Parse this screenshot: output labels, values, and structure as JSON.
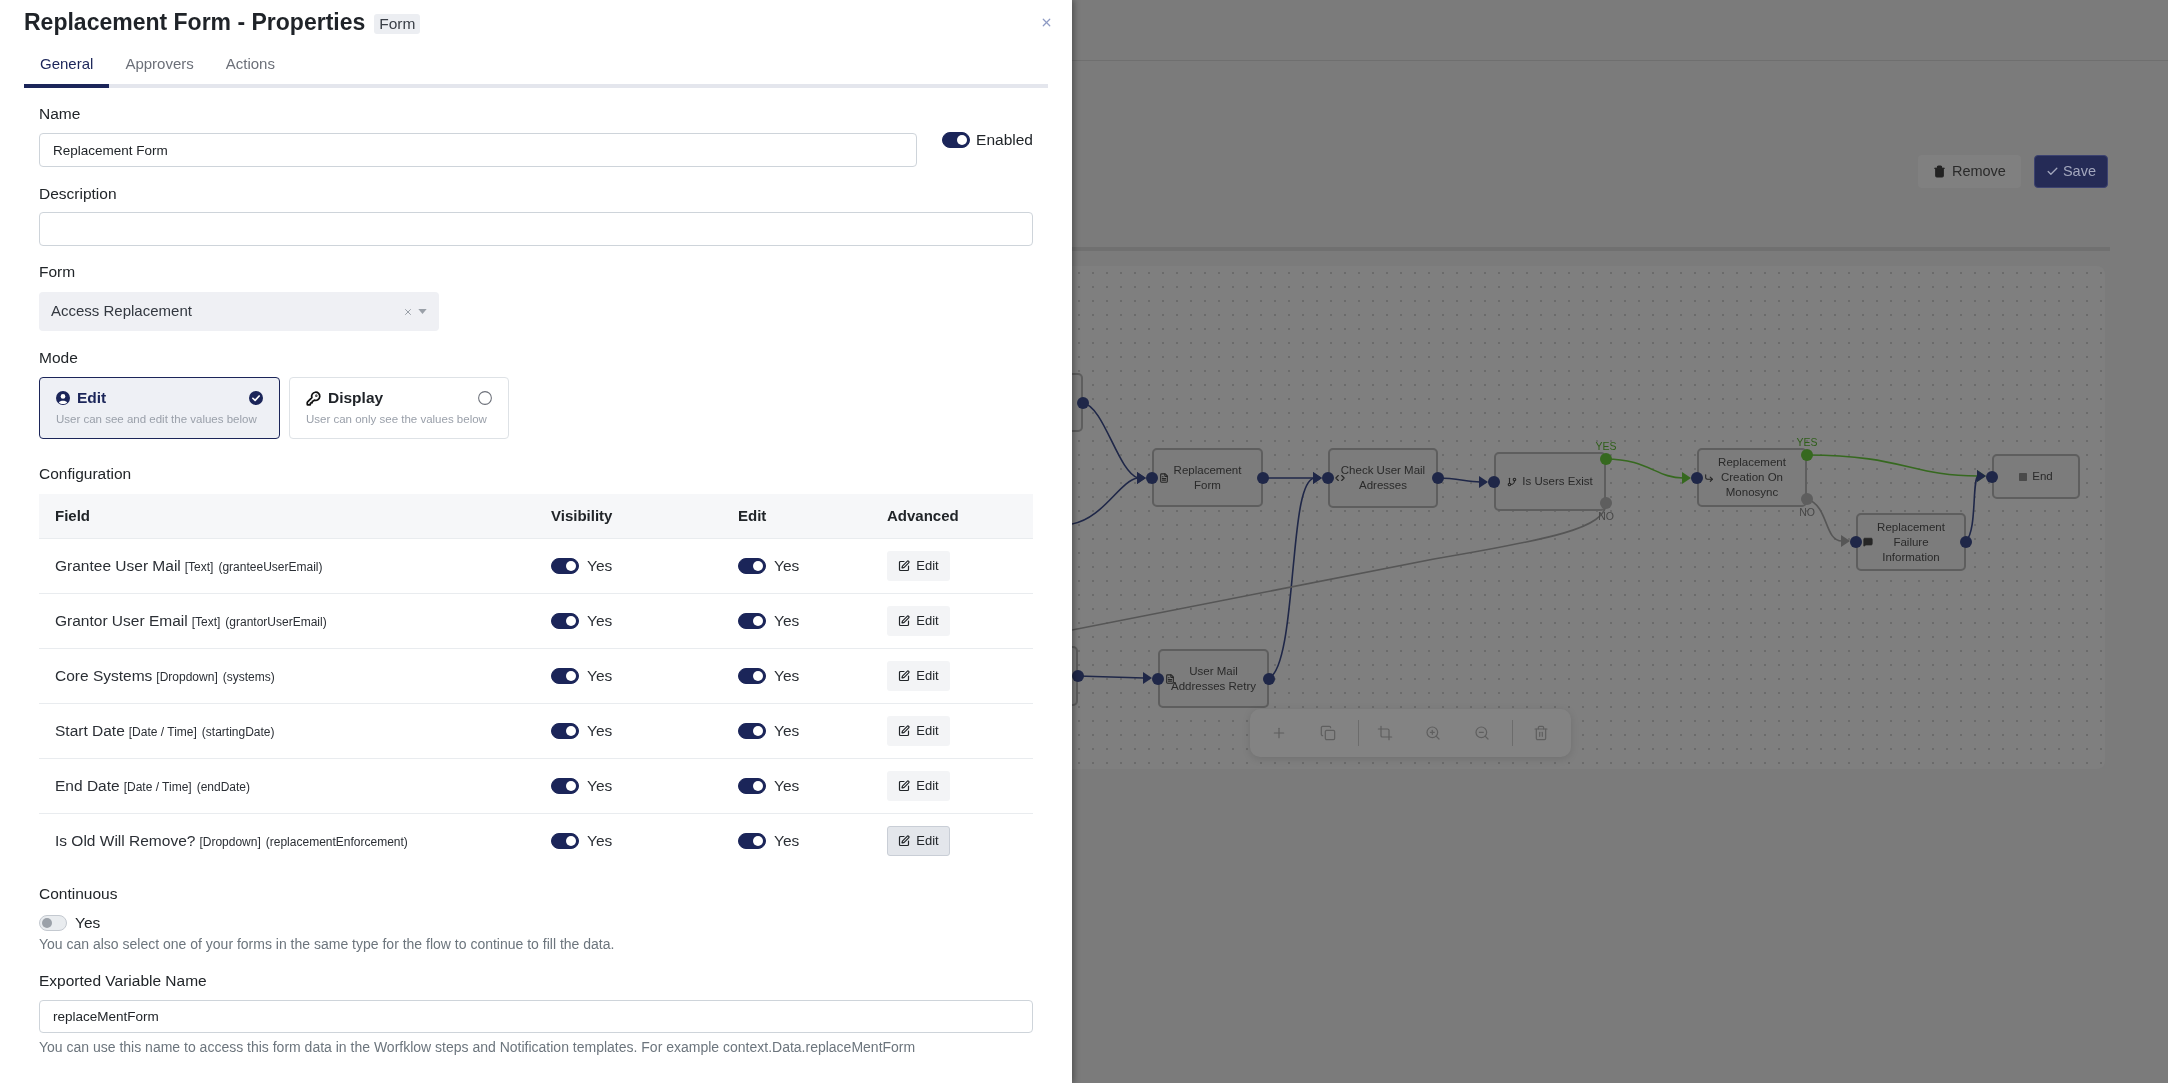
{
  "drawer": {
    "title": "Replacement Form - Properties",
    "badge": "Form",
    "tabs": [
      {
        "label": "General",
        "selected": true
      },
      {
        "label": "Approvers",
        "selected": false
      },
      {
        "label": "Actions",
        "selected": false
      }
    ]
  },
  "name": {
    "label": "Name",
    "value": "Replacement Form"
  },
  "enabled": {
    "label": "Enabled",
    "on": true
  },
  "description": {
    "label": "Description"
  },
  "form": {
    "label": "Form",
    "value": "Access Replacement"
  },
  "mode": {
    "label": "Mode",
    "options": [
      {
        "kind": "edit",
        "title": "Edit",
        "hint": "User can see and edit the values below",
        "selected": true
      },
      {
        "kind": "display",
        "title": "Display",
        "hint": "User can only see the values below",
        "selected": false
      }
    ]
  },
  "configuration": {
    "label": "Configuration",
    "columns": [
      "Field",
      "Visibility",
      "Edit",
      "Advanced"
    ],
    "rows": [
      {
        "field": "Grantee User Mail",
        "type": "[Text]",
        "key": "(granteeUserEmail)",
        "visible": true,
        "visible_label": "Yes",
        "editable": true,
        "editable_label": "Yes",
        "button": "Edit",
        "focused": false
      },
      {
        "field": "Grantor User Email",
        "type": "[Text]",
        "key": "(grantorUserEmail)",
        "visible": true,
        "visible_label": "Yes",
        "editable": true,
        "editable_label": "Yes",
        "button": "Edit",
        "focused": false
      },
      {
        "field": "Core Systems",
        "type": "[Dropdown]",
        "key": "(systems)",
        "visible": true,
        "visible_label": "Yes",
        "editable": true,
        "editable_label": "Yes",
        "button": "Edit",
        "focused": false
      },
      {
        "field": "Start Date",
        "type": "[Date / Time]",
        "key": "(startingDate)",
        "visible": true,
        "visible_label": "Yes",
        "editable": true,
        "editable_label": "Yes",
        "button": "Edit",
        "focused": false
      },
      {
        "field": "End Date",
        "type": "[Date / Time]",
        "key": "(endDate)",
        "visible": true,
        "visible_label": "Yes",
        "editable": true,
        "editable_label": "Yes",
        "button": "Edit",
        "focused": false
      },
      {
        "field": "Is Old Will Remove?",
        "type": "[Dropdown]",
        "key": "(replacementEnforcement)",
        "visible": true,
        "visible_label": "Yes",
        "editable": true,
        "editable_label": "Yes",
        "button": "Edit",
        "focused": true
      }
    ]
  },
  "continuous": {
    "label": "Continuous",
    "on": false,
    "toggle_label": "Yes",
    "help": "You can also select one of your forms in the same type for the flow to continue to fill the data."
  },
  "exported_variable": {
    "label": "Exported Variable Name",
    "value": "replaceMentForm",
    "help": "You can use this name to access this form data in the Worfklow steps and Notification templates. For example context.Data.replaceMentForm"
  },
  "workflow": {
    "actions": [
      {
        "kind": "remove",
        "label": "Remove"
      },
      {
        "kind": "save",
        "label": "Save"
      }
    ],
    "nodes": [
      {
        "kind": "form",
        "label": "Replacement\nForm"
      },
      {
        "kind": "script",
        "label": "Check User Mail\nAdresses"
      },
      {
        "kind": "condition",
        "label": "Is Users Exist",
        "branches": [
          "YES",
          "NO"
        ]
      },
      {
        "kind": "action",
        "label": "Replacement\nCreation On\nMonosync",
        "branches": [
          "YES",
          "NO"
        ]
      },
      {
        "kind": "end",
        "label": "End"
      },
      {
        "kind": "message",
        "label": "Replacement\nFailure\nInformation"
      },
      {
        "kind": "form",
        "label": "User Mail\nAddresses Retry"
      }
    ]
  }
}
